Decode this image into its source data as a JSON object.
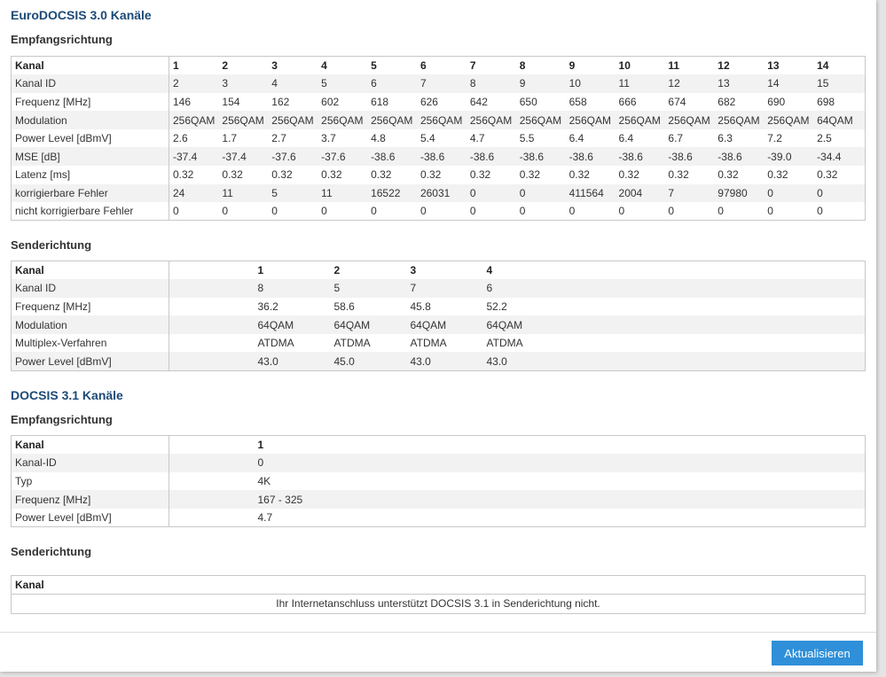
{
  "euro30": {
    "title": "EuroDOCSIS 3.0 Kanäle",
    "downstream": {
      "title": "Empfangsrichtung",
      "header_label": "Kanal",
      "channels": [
        "1",
        "2",
        "3",
        "4",
        "5",
        "6",
        "7",
        "8",
        "9",
        "10",
        "11",
        "12",
        "13",
        "14"
      ],
      "rows": [
        {
          "label": "Kanal ID",
          "values": [
            "2",
            "3",
            "4",
            "5",
            "6",
            "7",
            "8",
            "9",
            "10",
            "11",
            "12",
            "13",
            "14",
            "15"
          ]
        },
        {
          "label": "Frequenz [MHz]",
          "values": [
            "146",
            "154",
            "162",
            "602",
            "618",
            "626",
            "642",
            "650",
            "658",
            "666",
            "674",
            "682",
            "690",
            "698"
          ]
        },
        {
          "label": "Modulation",
          "values": [
            "256QAM",
            "256QAM",
            "256QAM",
            "256QAM",
            "256QAM",
            "256QAM",
            "256QAM",
            "256QAM",
            "256QAM",
            "256QAM",
            "256QAM",
            "256QAM",
            "256QAM",
            "64QAM"
          ]
        },
        {
          "label": "Power Level [dBmV]",
          "values": [
            "2.6",
            "1.7",
            "2.7",
            "3.7",
            "4.8",
            "5.4",
            "4.7",
            "5.5",
            "6.4",
            "6.4",
            "6.7",
            "6.3",
            "7.2",
            "2.5"
          ]
        },
        {
          "label": "MSE [dB]",
          "values": [
            "-37.4",
            "-37.4",
            "-37.6",
            "-37.6",
            "-38.6",
            "-38.6",
            "-38.6",
            "-38.6",
            "-38.6",
            "-38.6",
            "-38.6",
            "-38.6",
            "-39.0",
            "-34.4"
          ]
        },
        {
          "label": "Latenz [ms]",
          "values": [
            "0.32",
            "0.32",
            "0.32",
            "0.32",
            "0.32",
            "0.32",
            "0.32",
            "0.32",
            "0.32",
            "0.32",
            "0.32",
            "0.32",
            "0.32",
            "0.32"
          ]
        },
        {
          "label": "korrigierbare Fehler",
          "values": [
            "24",
            "11",
            "5",
            "11",
            "16522",
            "26031",
            "0",
            "0",
            "411564",
            "2004",
            "7",
            "97980",
            "0",
            "0"
          ]
        },
        {
          "label": "nicht korrigierbare Fehler",
          "values": [
            "0",
            "0",
            "0",
            "0",
            "0",
            "0",
            "0",
            "0",
            "0",
            "0",
            "0",
            "0",
            "0",
            "0"
          ]
        }
      ]
    },
    "upstream": {
      "title": "Senderichtung",
      "header_label": "Kanal",
      "channels": [
        "1",
        "2",
        "3",
        "4"
      ],
      "rows": [
        {
          "label": "Kanal ID",
          "values": [
            "8",
            "5",
            "7",
            "6"
          ]
        },
        {
          "label": "Frequenz [MHz]",
          "values": [
            "36.2",
            "58.6",
            "45.8",
            "52.2"
          ]
        },
        {
          "label": "Modulation",
          "values": [
            "64QAM",
            "64QAM",
            "64QAM",
            "64QAM"
          ]
        },
        {
          "label": "Multiplex-Verfahren",
          "values": [
            "ATDMA",
            "ATDMA",
            "ATDMA",
            "ATDMA"
          ]
        },
        {
          "label": "Power Level [dBmV]",
          "values": [
            "43.0",
            "45.0",
            "43.0",
            "43.0"
          ]
        }
      ]
    }
  },
  "docsis31": {
    "title": "DOCSIS 3.1 Kanäle",
    "downstream": {
      "title": "Empfangsrichtung",
      "header_label": "Kanal",
      "channels": [
        "1"
      ],
      "rows": [
        {
          "label": "Kanal-ID",
          "values": [
            "0"
          ]
        },
        {
          "label": "Typ",
          "values": [
            "4K"
          ]
        },
        {
          "label": "Frequenz [MHz]",
          "values": [
            "167 - 325"
          ]
        },
        {
          "label": "Power Level [dBmV]",
          "values": [
            "4.7"
          ]
        }
      ]
    },
    "upstream": {
      "title": "Senderichtung",
      "header_label": "Kanal",
      "message": "Ihr Internetanschluss unterstützt DOCSIS 3.1 in Senderichtung nicht."
    }
  },
  "refresh_button": "Aktualisieren",
  "colors": {
    "heading": "#1c4a77",
    "button": "#2f8fd8",
    "row_stripe": "#f2f2f2"
  }
}
